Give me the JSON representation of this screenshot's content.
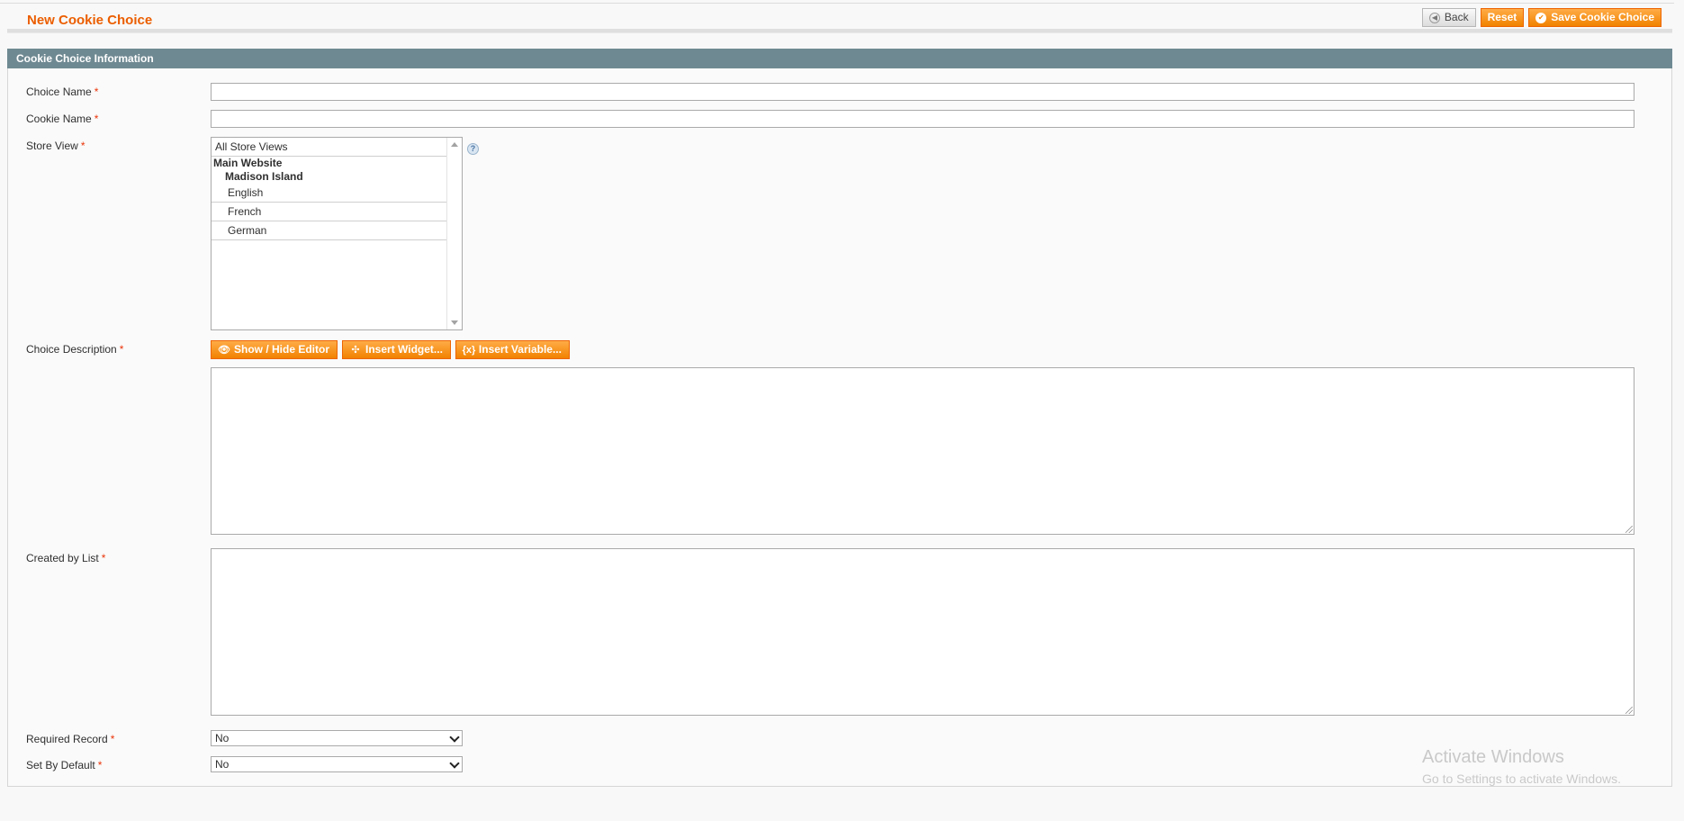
{
  "header": {
    "title": "New Cookie Choice",
    "buttons": {
      "back": "Back",
      "reset": "Reset",
      "save": "Save Cookie Choice"
    }
  },
  "section": {
    "title": "Cookie Choice Information"
  },
  "form": {
    "required_mark": "*",
    "choice_name": {
      "label": "Choice Name",
      "value": ""
    },
    "cookie_name": {
      "label": "Cookie Name",
      "value": ""
    },
    "store_view": {
      "label": "Store View",
      "options": {
        "all": "All Store Views",
        "website": "Main Website",
        "store": "Madison Island",
        "views": [
          "English",
          "French",
          "German"
        ]
      }
    },
    "choice_description": {
      "label": "Choice Description",
      "editor_buttons": {
        "show_hide": "Show / Hide Editor",
        "insert_widget": "Insert Widget...",
        "insert_variable": "Insert Variable..."
      },
      "value": ""
    },
    "created_by_list": {
      "label": "Created by List",
      "value": ""
    },
    "required_record": {
      "label": "Required Record",
      "value": "No"
    },
    "set_by_default": {
      "label": "Set By Default",
      "value": "No"
    }
  },
  "watermark": {
    "title": "Activate Windows",
    "subtitle": "Go to Settings to activate Windows."
  },
  "colors": {
    "accent": "#eb5e00",
    "button": "#f18200",
    "section_header": "#6f8992",
    "required": "#eb340a"
  }
}
